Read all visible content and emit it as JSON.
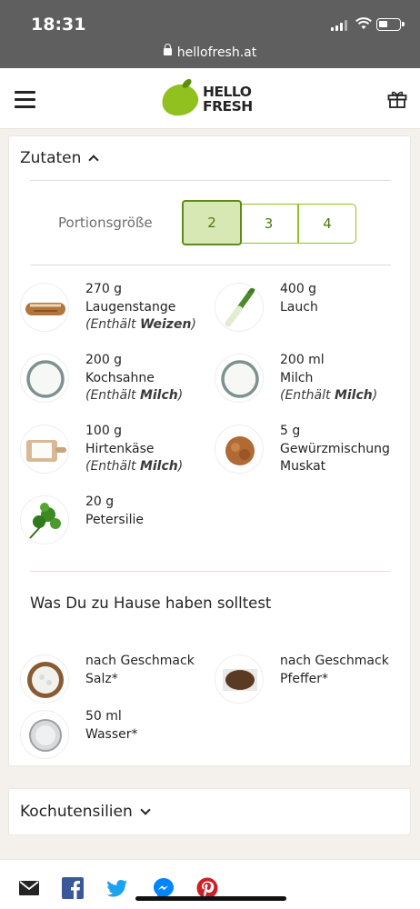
{
  "status_bar": {
    "time": "18:31",
    "url": "hellofresh.at"
  },
  "header": {
    "logo_line1": "HELLO",
    "logo_line2": "FRESH",
    "menu_icon": "hamburger-icon",
    "gift_icon": "gift-icon"
  },
  "ingredients_section": {
    "title": "Zutaten",
    "portion_label": "Portionsgröße",
    "portion_options": [
      "2",
      "3",
      "4"
    ],
    "selected_portion": "2",
    "items": [
      {
        "amount": "270 g",
        "name": "Laugenstange",
        "allergen_prefix": "(Enthält ",
        "allergen": "Weizen",
        "allergen_suffix": ")"
      },
      {
        "amount": "400 g",
        "name": "Lauch"
      },
      {
        "amount": "200 g",
        "name": "Kochsahne",
        "allergen_prefix": "(Enthält ",
        "allergen": "Milch",
        "allergen_suffix": ")"
      },
      {
        "amount": "200 ml",
        "name": "Milch",
        "allergen_prefix": "(Enthält ",
        "allergen": "Milch",
        "allergen_suffix": ")"
      },
      {
        "amount": "100 g",
        "name": "Hirtenkäse",
        "allergen_prefix": "(Enthält ",
        "allergen": "Milch",
        "allergen_suffix": ")"
      },
      {
        "amount": "5 g",
        "name": "Gewürzmischung",
        "name2": "Muskat"
      },
      {
        "amount": "20 g",
        "name": "Petersilie"
      }
    ],
    "pantry_title": "Was Du zu Hause haben solltest",
    "pantry": [
      {
        "amount": "nach Geschmack",
        "name": "Salz*"
      },
      {
        "amount": "nach Geschmack",
        "name": "Pfeffer*"
      },
      {
        "amount": "50 ml",
        "name": "Wasser*"
      }
    ]
  },
  "utensils_section": {
    "title": "Kochutensilien"
  },
  "share_bar": {
    "icons": [
      "mail-icon",
      "facebook-icon",
      "twitter-icon",
      "messenger-icon",
      "pinterest-icon"
    ]
  },
  "colors": {
    "brand_green": "#91c11e",
    "selected_fill": "#d7e8b4",
    "text_green": "#4d7a0c"
  }
}
